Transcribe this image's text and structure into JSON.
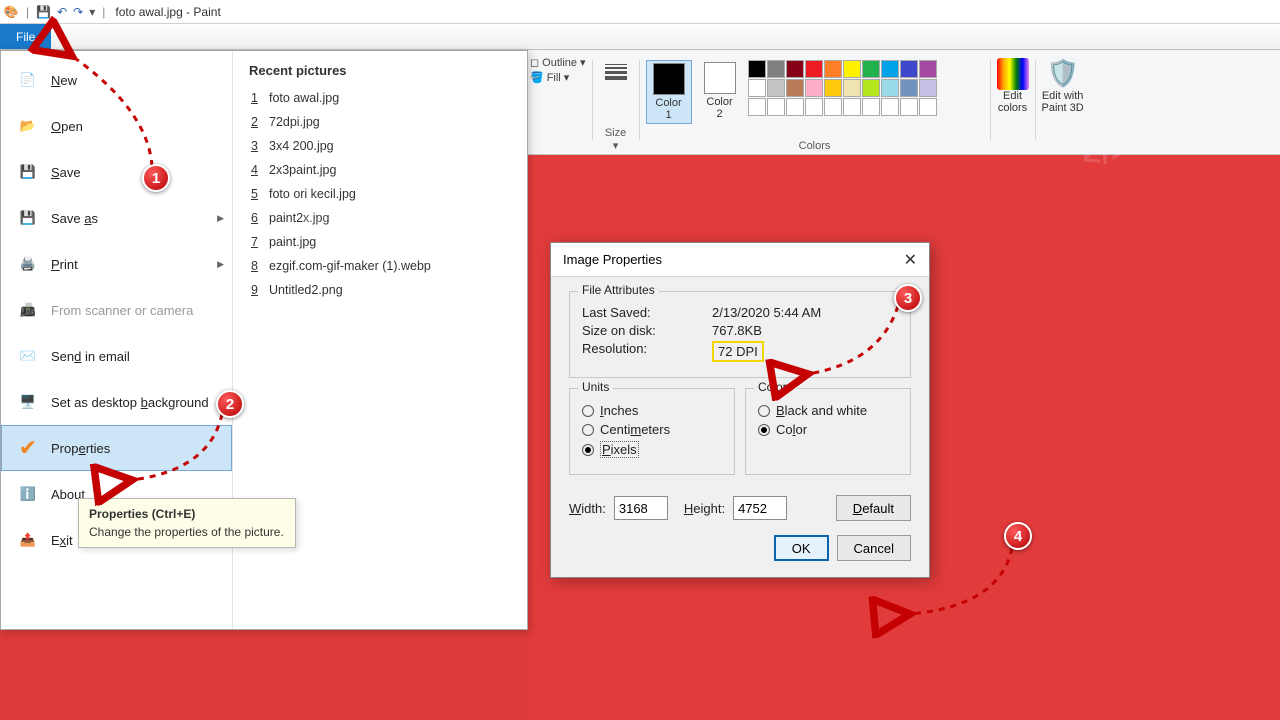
{
  "title": {
    "filename": "foto awal.jpg",
    "appname": "Paint"
  },
  "menu": {
    "file": "File"
  },
  "filemenu": {
    "new": "New",
    "open": "Open",
    "save": "Save",
    "saveas": "Save as",
    "print": "Print",
    "scanner": "From scanner or camera",
    "email": "Send in email",
    "background": "Set as desktop background",
    "properties": "Properties",
    "about": "About",
    "exit": "Exit"
  },
  "recent": {
    "header": "Recent pictures",
    "items": [
      "foto awal.jpg",
      "72dpi.jpg",
      "3x4 200.jpg",
      "2x3paint.jpg",
      "foto ori kecil.jpg",
      "paint2x.jpg",
      "paint.jpg",
      "ezgif.com-gif-maker (1).webp",
      "Untitled2.png"
    ]
  },
  "tooltip": {
    "title": "Properties (Ctrl+E)",
    "body": "Change the properties of the picture."
  },
  "ribbon": {
    "outline": "Outline",
    "fill": "Fill",
    "size": "Size",
    "color1": "Color\n1",
    "color2": "Color\n2",
    "colors": "Colors",
    "edit": "Edit\ncolors",
    "paint3d": "Edit with\nPaint 3D"
  },
  "swatches_row1": [
    "#000",
    "#7f7f7f",
    "#880015",
    "#ed1c24",
    "#ff7f27",
    "#fff200",
    "#22b14c",
    "#00a2e8",
    "#3f48cc",
    "#a349a4"
  ],
  "swatches_row2": [
    "#fff",
    "#c3c3c3",
    "#b97a57",
    "#ffaec9",
    "#ffc90e",
    "#efe4b0",
    "#b5e61d",
    "#99d9ea",
    "#7092be",
    "#c8bfe7"
  ],
  "swatches_row3": [
    "#fff",
    "#fff",
    "#fff",
    "#fff",
    "#fff",
    "#fff",
    "#fff",
    "#fff",
    "#fff",
    "#fff"
  ],
  "dialog": {
    "title": "Image Properties",
    "fileattr": "File Attributes",
    "lastsaved_k": "Last Saved:",
    "lastsaved_v": "2/13/2020 5:44 AM",
    "size_k": "Size on disk:",
    "size_v": "767.8KB",
    "res_k": "Resolution:",
    "res_v": "72 DPI",
    "units": "Units",
    "inches": "Inches",
    "cm": "Centimeters",
    "pixels": "Pixels",
    "colors": "Colors",
    "bw": "Black and white",
    "color": "Color",
    "width_l": "Width:",
    "width_v": "3168",
    "height_l": "Height:",
    "height_v": "4752",
    "default": "Default",
    "ok": "OK",
    "cancel": "Cancel"
  },
  "anno": {
    "b1": "1",
    "b2": "2",
    "b3": "3",
    "b4": "4"
  }
}
